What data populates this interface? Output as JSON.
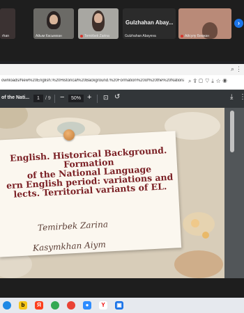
{
  "meeting": {
    "participants": [
      {
        "name": "rhan",
        "muted": false
      },
      {
        "name": "Айым Касымхан",
        "muted": false
      },
      {
        "name": "Temirbek Zarina",
        "muted": true
      },
      {
        "name": "Gulzhahan Abayeva",
        "muted": false,
        "big_name": "Gulzhahan Abay..."
      },
      {
        "name": "Айсулу Бекжан",
        "muted": true
      }
    ],
    "next_icon": "chevron-right-icon"
  },
  "browser": {
    "url": "ownloads/New%20English.%20Historical%20Background.%20Formation%20of%20the%20National%2",
    "address_icons": [
      "search-icon",
      "share-icon",
      "lock-icon",
      "heart-icon",
      "download-icon",
      "star-icon",
      "profile-icon"
    ]
  },
  "pdf_toolbar": {
    "title": "of the Nati...",
    "page_current": "1",
    "page_total": "/ 9",
    "zoom": "50%"
  },
  "slide": {
    "title_lines": [
      "English. Historical Background.",
      "Formation",
      "of the National Language",
      "ern English period: variations and",
      "lects. Territorial variants of EL."
    ],
    "authors": [
      "Temirbek Zarina",
      "Kasymkhan Aiym"
    ],
    "colors": {
      "title": "#7a1f24",
      "paper": "#fbf7ef",
      "background": "#d8cdb9"
    }
  },
  "taskbar": {
    "apps": [
      "chrome-icon",
      "beeline-icon",
      "yandex-icon",
      "chrome-icon",
      "chrome-icon",
      "zoom-icon",
      "yandex-icon",
      "meet-icon"
    ]
  }
}
